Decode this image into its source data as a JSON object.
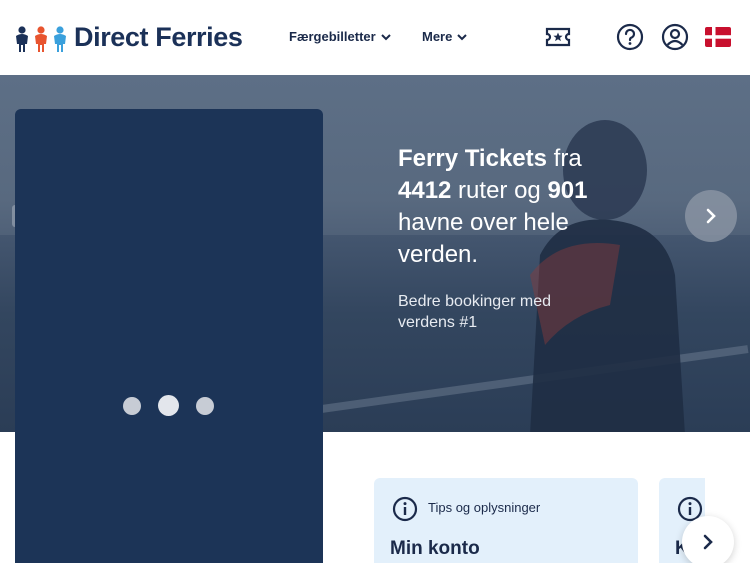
{
  "header": {
    "logo_text": "Direct Ferries",
    "nav": [
      {
        "label": "Færgebilletter"
      },
      {
        "label": "Mere"
      }
    ],
    "icons": [
      "ticket-icon",
      "help-icon",
      "account-icon",
      "flag-denmark-icon"
    ]
  },
  "hero": {
    "title_parts": {
      "strong1": "Ferry Tickets",
      "text1": " fra ",
      "strong2": "4412",
      "text2": " ruter og ",
      "strong3": "901",
      "text3": " havne over hele verden."
    },
    "subtitle": "Bedre bookinger med verdens #1"
  },
  "booking": {
    "loading_dots": 3
  },
  "info_cards": [
    {
      "tag": "Tips og oplysninger",
      "title": "Min konto"
    },
    {
      "tag": "",
      "title": "K"
    }
  ],
  "colors": {
    "brand_navy": "#1b3158",
    "booking_card": "#1c3457",
    "info_card_bg": "#e3f0fb",
    "flag_red": "#c8102e"
  }
}
